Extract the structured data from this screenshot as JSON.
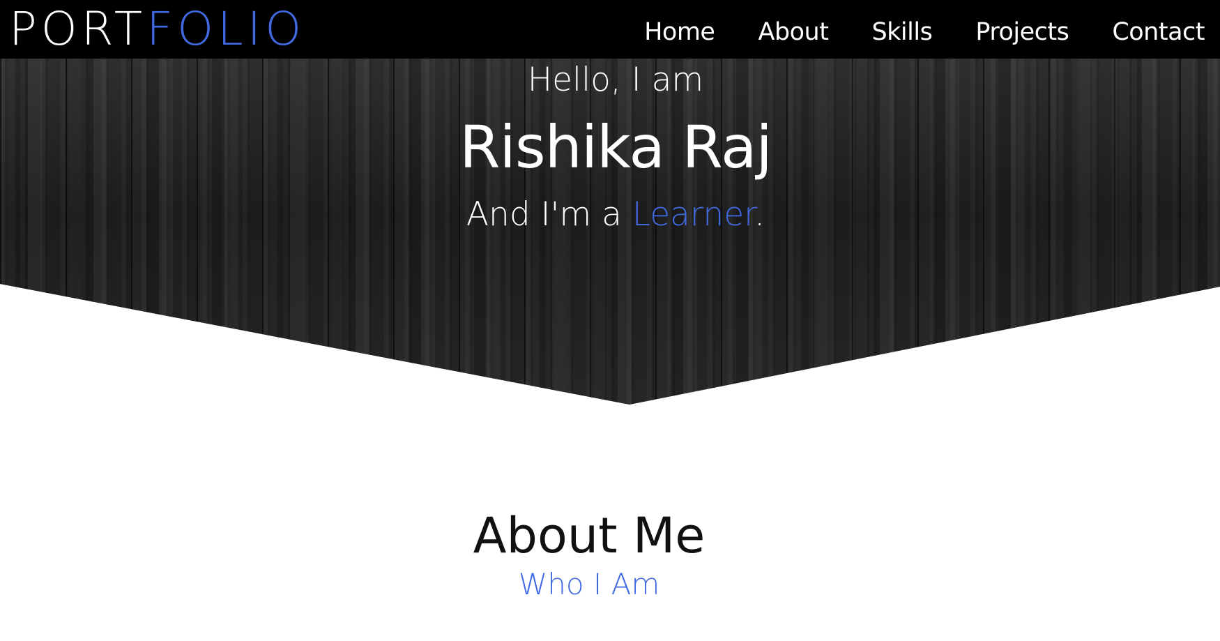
{
  "navbar": {
    "logo_part1": "PORT",
    "logo_part2": "FOLIO",
    "menu": [
      {
        "label": "Home"
      },
      {
        "label": "About"
      },
      {
        "label": "Skills"
      },
      {
        "label": "Projects"
      },
      {
        "label": "Contact"
      }
    ]
  },
  "hero": {
    "greeting": "Hello, I am",
    "name": "Rishika Raj",
    "role_prefix": "And I'm a ",
    "role_highlight": "Learner",
    "role_suffix": "."
  },
  "about": {
    "title": "About Me",
    "subtitle": "Who I Am"
  },
  "colors": {
    "accent": "#4169e1",
    "navbar_bg": "#000000",
    "text_light": "#ffffff",
    "hero_bg": "dark wood texture"
  }
}
